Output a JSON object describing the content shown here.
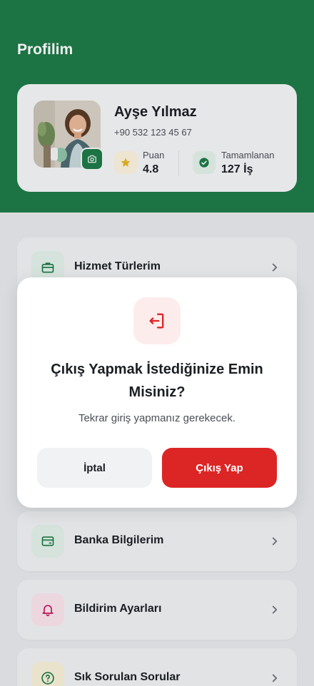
{
  "header": {
    "title": "Profilim"
  },
  "profile": {
    "name": "Ayşe Yılmaz",
    "phone": "+90 532 123 45 67",
    "stats": [
      {
        "label": "Puan",
        "value": "4.8",
        "icon": "star-icon",
        "icon_color": "#e6b422",
        "bg": "#fbf3dc"
      },
      {
        "label": "Tamamlanan",
        "value": "127 İş",
        "icon": "check-circle-icon",
        "icon_color": "#1d7a46",
        "bg": "#e2f1e8"
      }
    ]
  },
  "menu": {
    "items": [
      {
        "label": "Hizmet Türlerim",
        "icon": "briefcase-icon",
        "bg": "#e2f1e8",
        "color": "#1d7a46"
      },
      {
        "label": "Banka Bilgilerim",
        "icon": "wallet-icon",
        "bg": "#e2f1e8",
        "color": "#1d7a46"
      },
      {
        "label": "Bildirim Ayarları",
        "icon": "bell-icon",
        "bg": "#fbe4ea",
        "color": "#c2185b"
      },
      {
        "label": "Sık Sorulan Sorular",
        "icon": "help-circle-icon",
        "bg": "#f7f0d8",
        "color": "#1d7a46"
      }
    ]
  },
  "modal": {
    "icon": "logout-icon",
    "title": "Çıkış Yapmak İstediğinize Emin Misiniz?",
    "subtitle": "Tekrar giriş yapmanız gerekecek.",
    "cancel_label": "İptal",
    "confirm_label": "Çıkış Yap"
  },
  "colors": {
    "brand": "#1d7a46",
    "danger": "#dc2626"
  }
}
